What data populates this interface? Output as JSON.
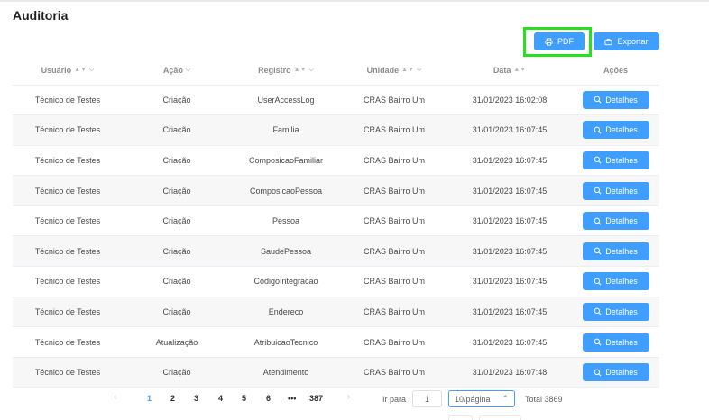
{
  "page": {
    "title": "Auditoria"
  },
  "toolbar": {
    "pdf_label": "PDF",
    "export_label": "Exportar"
  },
  "colors": {
    "primary": "#409eff",
    "highlight": "#29e01f"
  },
  "table": {
    "headers": [
      "Usuário",
      "Ação",
      "Registro",
      "Unidade",
      "Data",
      "Ações"
    ],
    "detail_label": "Detalhes",
    "rows": [
      [
        "Técnico de Testes",
        "Criação",
        "UserAccessLog",
        "CRAS Bairro Um",
        "31/01/2023 16:02:08"
      ],
      [
        "Técnico de Testes",
        "Criação",
        "Familia",
        "CRAS Bairro Um",
        "31/01/2023 16:07:45"
      ],
      [
        "Técnico de Testes",
        "Criação",
        "ComposicaoFamiliar",
        "CRAS Bairro Um",
        "31/01/2023 16:07:45"
      ],
      [
        "Técnico de Testes",
        "Criação",
        "ComposicaoPessoa",
        "CRAS Bairro Um",
        "31/01/2023 16:07:45"
      ],
      [
        "Técnico de Testes",
        "Criação",
        "Pessoa",
        "CRAS Bairro Um",
        "31/01/2023 16:07:45"
      ],
      [
        "Técnico de Testes",
        "Criação",
        "SaudePessoa",
        "CRAS Bairro Um",
        "31/01/2023 16:07:45"
      ],
      [
        "Técnico de Testes",
        "Criação",
        "CodigoIntegracao",
        "CRAS Bairro Um",
        "31/01/2023 16:07:45"
      ],
      [
        "Técnico de Testes",
        "Criação",
        "Endereco",
        "CRAS Bairro Um",
        "31/01/2023 16:07:45"
      ],
      [
        "Técnico de Testes",
        "Atualização",
        "AtribuicaoTecnico",
        "CRAS Bairro Um",
        "31/01/2023 16:07:45"
      ],
      [
        "Técnico de Testes",
        "Criação",
        "Atendimento",
        "CRAS Bairro Um",
        "31/01/2023 16:07:48"
      ]
    ]
  },
  "pagination": {
    "pages": [
      "1",
      "2",
      "3",
      "4",
      "5",
      "6",
      "•••",
      "387"
    ],
    "current_page": "1",
    "goto_label": "Ir para",
    "goto_value": "1",
    "page_size": "10/página",
    "total": "Total 3869"
  }
}
